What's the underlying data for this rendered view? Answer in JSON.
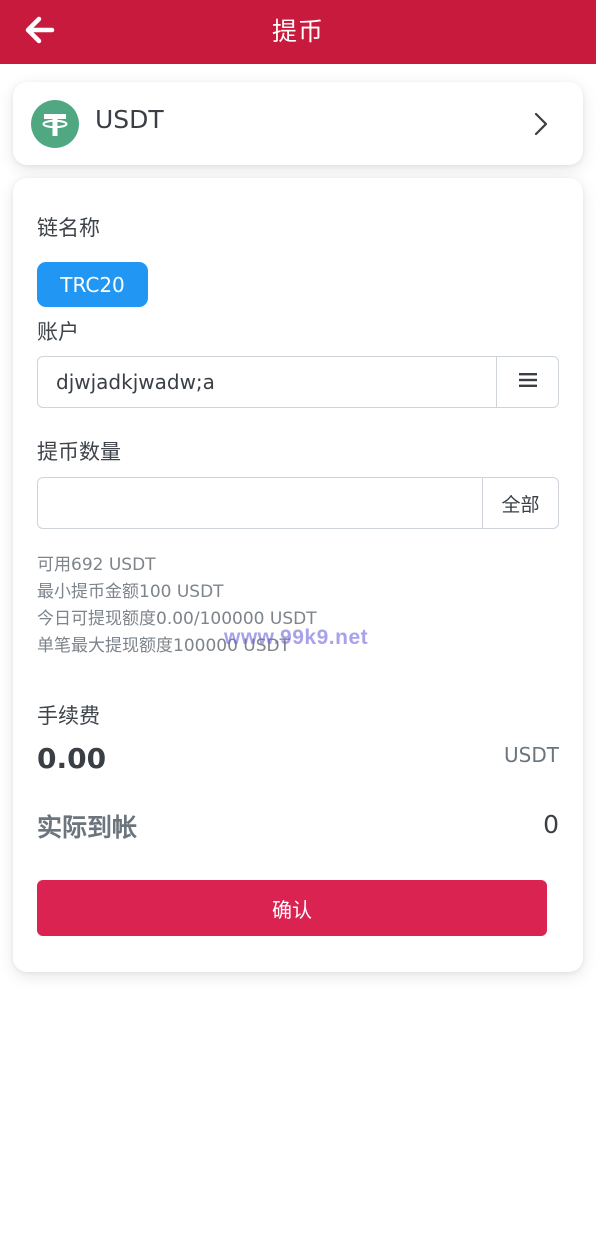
{
  "header": {
    "title": "提币",
    "back_icon": "arrow-left-icon"
  },
  "coin": {
    "name": "USDT",
    "logo_icon": "tether-icon",
    "logo_color": "#50a883",
    "chevron_icon": "chevron-right-icon"
  },
  "form": {
    "chain_label": "链名称",
    "chain_option": "TRC20",
    "account_label": "账户",
    "account_value": "djwjadkjwadw;a",
    "account_menu_icon": "menu-icon",
    "amount_label": "提币数量",
    "amount_value": "",
    "amount_placeholder": "",
    "all_label": "全部",
    "info": [
      "可用692 USDT",
      "最小提币金额100 USDT",
      "今日可提现额度0.00/100000 USDT",
      "单笔最大提现额度100000 USDT"
    ],
    "fee_label": "手续费",
    "fee_value": "0.00",
    "fee_unit": "USDT",
    "arrive_label": "实际到帐",
    "arrive_value": "0",
    "confirm_label": "确认"
  },
  "watermark": "www.99k9.net",
  "colors": {
    "header_bg": "#c81a3d",
    "chain_btn": "#2196f3",
    "confirm_btn": "#db2352"
  }
}
